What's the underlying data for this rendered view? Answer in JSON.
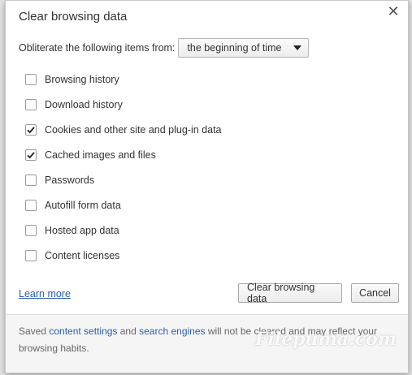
{
  "dialog": {
    "title": "Clear browsing data",
    "close_icon": "close-icon"
  },
  "range": {
    "label": "Obliterate the following items from:",
    "selected": "the beginning of time"
  },
  "options": [
    {
      "label": "Browsing history",
      "checked": false
    },
    {
      "label": "Download history",
      "checked": false
    },
    {
      "label": "Cookies and other site and plug-in data",
      "checked": true
    },
    {
      "label": "Cached images and files",
      "checked": true
    },
    {
      "label": "Passwords",
      "checked": false
    },
    {
      "label": "Autofill form data",
      "checked": false
    },
    {
      "label": "Hosted app data",
      "checked": false
    },
    {
      "label": "Content licenses",
      "checked": false
    }
  ],
  "learn_more": "Learn more",
  "buttons": {
    "clear": "Clear browsing data",
    "cancel": "Cancel"
  },
  "footer": {
    "prefix": "Saved ",
    "link1": "content settings",
    "middle": " and ",
    "link2": "search engines",
    "suffix": " will not be cleared and may reflect your browsing habits."
  },
  "watermark": "Filepuma.com",
  "colors": {
    "link": "#2a5db0"
  }
}
